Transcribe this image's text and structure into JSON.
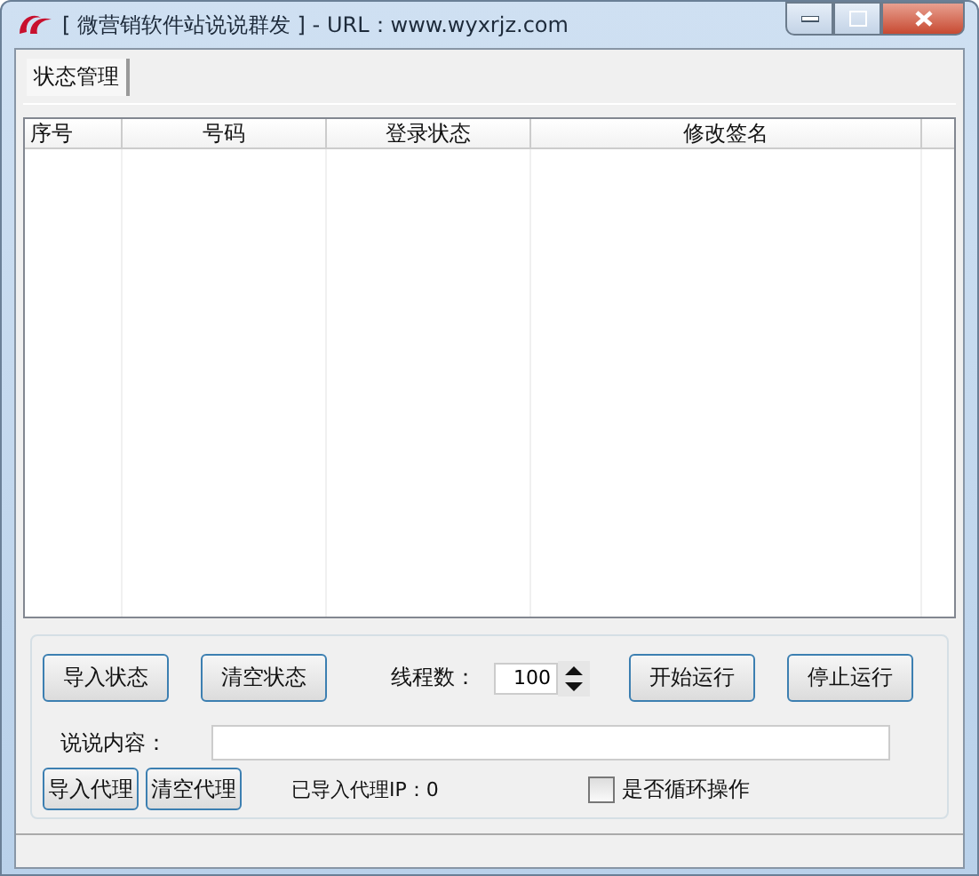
{
  "window": {
    "title": "[ 微营销软件站说说群发 ] - URL：www.wyxrjz.com"
  },
  "tabs": [
    {
      "label": "状态管理",
      "selected": true
    }
  ],
  "table": {
    "columns": [
      "序号",
      "号码",
      "登录状态",
      "修改签名"
    ]
  },
  "row1_buttons": [
    "导入状态",
    "清空状态"
  ],
  "thread_count": {
    "label": "线程数：",
    "value": "100"
  },
  "run_buttons": [
    "开始运行",
    "停止运行"
  ],
  "content": {
    "label": "说说内容："
  },
  "proxy_buttons": [
    "导入代理",
    "清空代理"
  ],
  "proxy_status": "已导入代理IP：0",
  "loop": {
    "label": "是否循环操作",
    "checked": false
  }
}
